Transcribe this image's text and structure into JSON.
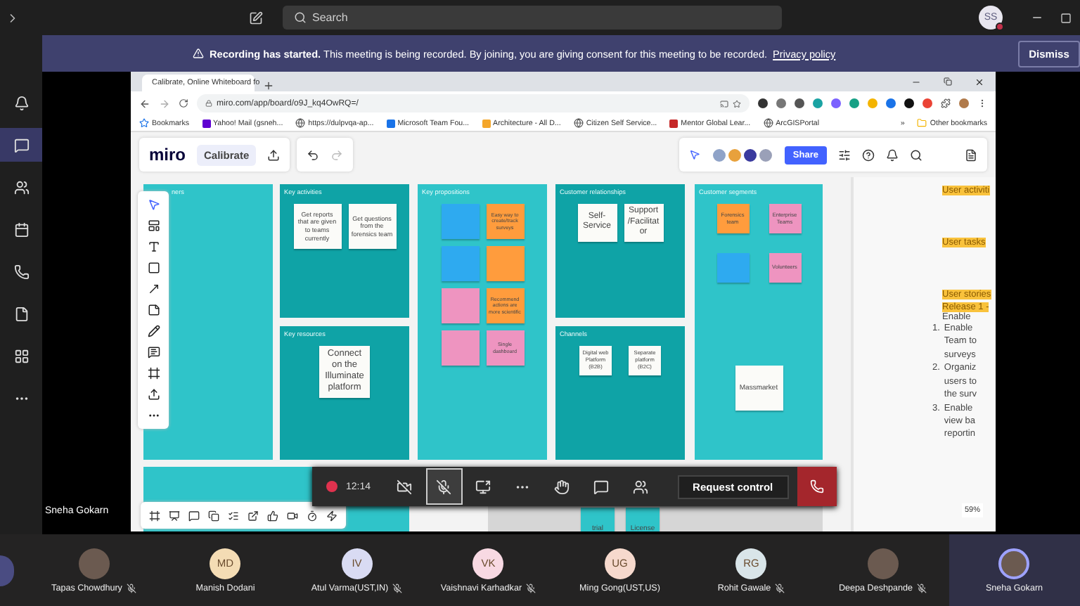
{
  "top_bar": {
    "search": {
      "placeholder": "Search"
    },
    "avatar": {
      "initials": "SS"
    }
  },
  "rail": [
    {
      "kind": "activity",
      "selected": false
    },
    {
      "kind": "chat",
      "selected": true
    },
    {
      "kind": "teams",
      "selected": false
    },
    {
      "kind": "calendar",
      "selected": false
    },
    {
      "kind": "calls",
      "selected": false
    },
    {
      "kind": "files",
      "selected": false
    },
    {
      "kind": "apps",
      "selected": false
    },
    {
      "kind": "more",
      "selected": false
    }
  ],
  "banner": {
    "title": "Recording has started.",
    "message": "This meeting is being recorded. By joining, you are giving consent for this meeting to be recorded.",
    "link": "Privacy policy",
    "button": "Dismiss"
  },
  "browser": {
    "tab": {
      "title": "Calibrate, Online Whiteboard fo"
    },
    "url": "miro.com/app/board/o9J_kq4OwRQ=/",
    "bookmarks": [
      {
        "label": "Bookmarks",
        "kind": "star"
      },
      {
        "label": "Yahoo! Mail (gsneh...",
        "kind": "mail"
      },
      {
        "label": "https://dulpvqa-ap...",
        "kind": "web"
      },
      {
        "label": "Microsoft Team Fou...",
        "kind": "teams"
      },
      {
        "label": "Architecture - All D...",
        "kind": "doc"
      },
      {
        "label": "Citizen Self Service...",
        "kind": "web"
      },
      {
        "label": "Mentor Global Lear...",
        "kind": "logo"
      },
      {
        "label": "ArcGISPortal",
        "kind": "web"
      }
    ],
    "overflow": "»",
    "other_bookmarks": "Other bookmarks"
  },
  "miro": {
    "logo": "miro",
    "board_name": "Calibrate",
    "share": "Share",
    "zoom": "59%",
    "frames": [
      {
        "title": "ners",
        "color": "#2fc4c9"
      },
      {
        "title": "Key activities",
        "color": "#0fa3a6",
        "notes": [
          {
            "text": "Get reports that are given to teams currently",
            "color": "#fbfbf8"
          },
          {
            "text": "Get questions from the forensics team",
            "color": "#fbfbf8"
          }
        ]
      },
      {
        "title": "Key resources",
        "color": "#0fa3a6",
        "notes": [
          {
            "text": "Connect on the Illuminate platform",
            "color": "#fbfbf8"
          }
        ]
      },
      {
        "title": "Key propositions",
        "color": "#2fc4c9",
        "notes": [
          {
            "color": "#2eaaf0"
          },
          {
            "text": "Easy way to create/track surveys",
            "color": "#ff9c3d"
          },
          {
            "color": "#2eaaf0"
          },
          {
            "color": "#ff9c3d"
          },
          {
            "color": "#ee94c0"
          },
          {
            "text": "Recommend actions are more scientific",
            "color": "#ff9c3d"
          },
          {
            "color": "#ee94c0"
          },
          {
            "text": "Single dashboard",
            "color": "#ee94c0"
          }
        ]
      },
      {
        "title": "Customer relationships",
        "color": "#0fa3a6",
        "notes": [
          {
            "text": "Self-Service",
            "color": "#fbfbf8"
          },
          {
            "text": "Support /Facilitator",
            "color": "#fbfbf8"
          }
        ]
      },
      {
        "title": "Channels",
        "color": "#0fa3a6",
        "notes": [
          {
            "text": "Digital web Platform (B2B)",
            "color": "#fbfbf8"
          },
          {
            "text": "Separate platform (B2C)",
            "color": "#fbfbf8"
          }
        ]
      },
      {
        "title": "Customer segments",
        "color": "#2fc4c9",
        "notes": [
          {
            "text": "Forensics team",
            "color": "#ff9c3d"
          },
          {
            "text": "Enterprise Teams",
            "color": "#ee94c0"
          },
          {
            "color": "#2eaaf0"
          },
          {
            "text": "Volunteers",
            "color": "#ee94c0"
          },
          {
            "text": "Massmarket",
            "color": "#fbfbf8"
          }
        ]
      }
    ],
    "lower_notes": [
      {
        "text": "trial",
        "color": "#2fc4c9"
      },
      {
        "text": "License",
        "color": "#2fc4c9"
      }
    ],
    "doc": [
      {
        "kind": "heading",
        "text": "User activiti"
      },
      {
        "kind": "heading",
        "text": "User tasks"
      },
      {
        "kind": "heading",
        "text": "User stories"
      },
      {
        "kind": "heading",
        "text": "Release 1 -"
      },
      {
        "kind": "paragraph",
        "text": "Enable"
      },
      {
        "kind": "item",
        "number": "1.",
        "lines": [
          "Enable",
          "Team to",
          "surveys"
        ]
      },
      {
        "kind": "item",
        "number": "2.",
        "lines": [
          "Organiz",
          "users to",
          "the surv"
        ]
      },
      {
        "kind": "item",
        "number": "3.",
        "lines": [
          "Enable",
          "view ba",
          "reportin"
        ]
      }
    ]
  },
  "presenter": "Sneha Gokarn",
  "meeting_bar": {
    "timer": "12:14",
    "controls": [
      {
        "kind": "camera",
        "selected": false
      },
      {
        "kind": "mic",
        "selected": true
      },
      {
        "kind": "share",
        "selected": false
      },
      {
        "kind": "more",
        "selected": false
      },
      {
        "kind": "hand",
        "selected": false
      },
      {
        "kind": "chat",
        "selected": false
      },
      {
        "kind": "people",
        "selected": false
      }
    ],
    "request_control": "Request control"
  },
  "participants": [
    {
      "name": "Tapas Chowdhury",
      "kind": "photo",
      "muted": true,
      "speaking": false
    },
    {
      "name": "Manish Dodani",
      "kind": "initials",
      "initials": "MD",
      "color": "#f4dcb4",
      "muted": false,
      "speaking": false
    },
    {
      "name": "Atul Varma(UST,IN)",
      "kind": "initials",
      "initials": "IV",
      "color": "#d9dbf3",
      "muted": true,
      "speaking": false
    },
    {
      "name": "Vaishnavi Karhadkar",
      "kind": "initials",
      "initials": "VK",
      "color": "#f8d9e3",
      "muted": true,
      "speaking": false
    },
    {
      "name": "Ming Gong(UST,US)",
      "kind": "initials",
      "initials": "UG",
      "color": "#f6d9cd",
      "muted": false,
      "speaking": false
    },
    {
      "name": "Rohit Gawale",
      "kind": "initials",
      "initials": "RG",
      "color": "#d9e5e9",
      "muted": true,
      "speaking": false
    },
    {
      "name": "Deepa Deshpande",
      "kind": "photo",
      "muted": true,
      "speaking": false
    },
    {
      "name": "Sneha Gokarn",
      "kind": "photo",
      "muted": false,
      "speaking": true
    }
  ]
}
